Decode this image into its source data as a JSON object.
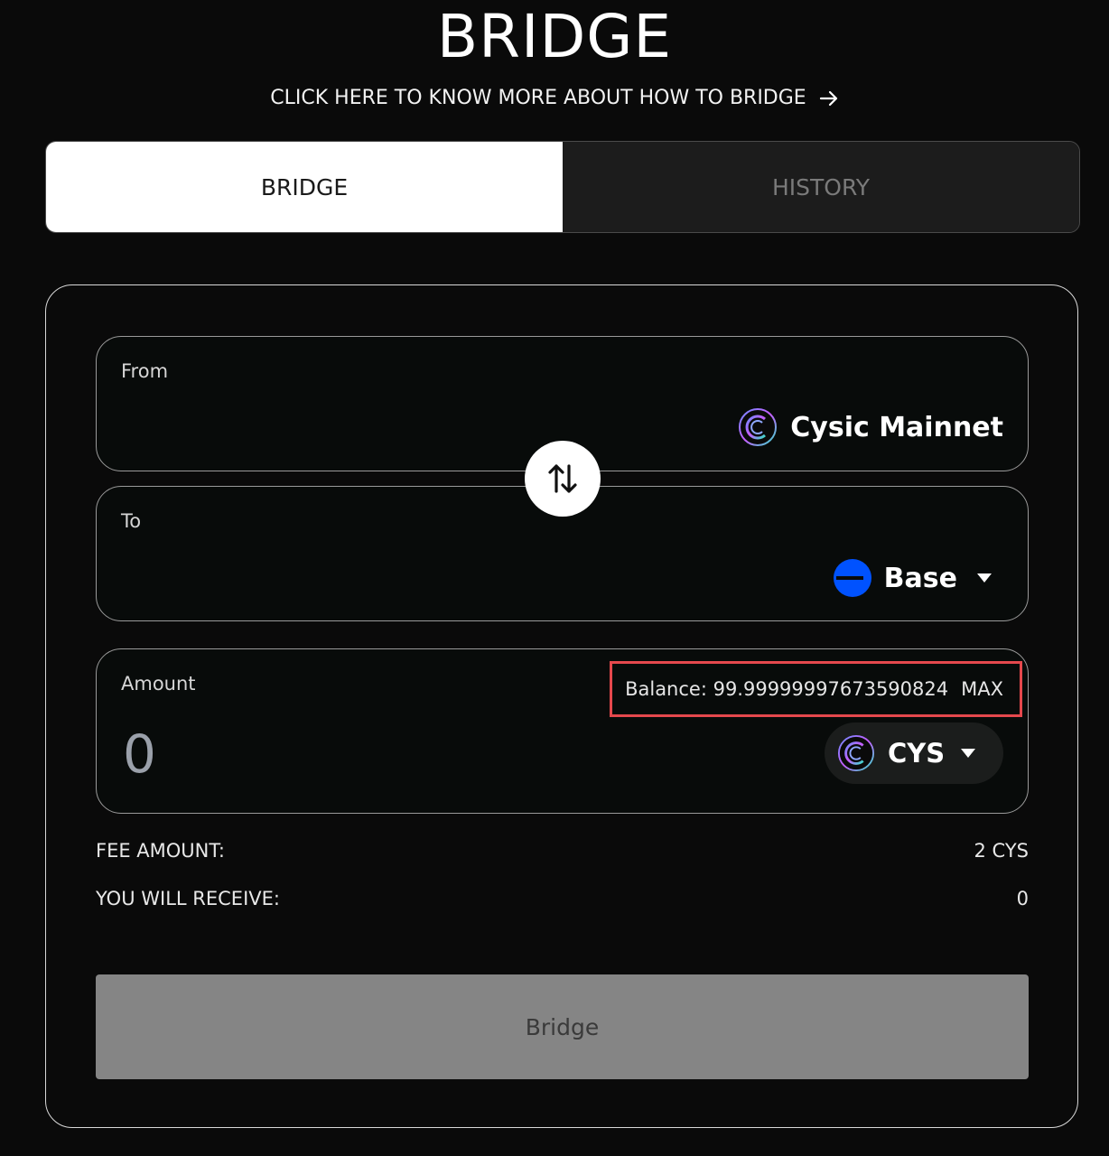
{
  "page": {
    "title": "BRIDGE",
    "howto_link": "CLICK HERE TO KNOW MORE ABOUT HOW TO BRIDGE"
  },
  "tabs": [
    {
      "label": "BRIDGE",
      "active": true
    },
    {
      "label": "HISTORY",
      "active": false
    }
  ],
  "from": {
    "label": "From",
    "chain": "Cysic Mainnet",
    "icon": "cysic-logo-icon"
  },
  "to": {
    "label": "To",
    "chain": "Base",
    "icon": "base-logo-icon"
  },
  "amount": {
    "label": "Amount",
    "value": "0",
    "balance": "Balance: 99.99999997673590824",
    "max_label": "MAX",
    "token": "CYS"
  },
  "summary": {
    "fee_label": "FEE AMOUNT:",
    "fee_value": "2 CYS",
    "receive_label": "YOU WILL RECEIVE:",
    "receive_value": "0"
  },
  "action": {
    "label": "Bridge",
    "enabled": false
  },
  "colors": {
    "background": "#0a0a0a",
    "highlight_border": "#e5484d",
    "base_blue": "#0052ff",
    "disabled_button": "#858585"
  }
}
